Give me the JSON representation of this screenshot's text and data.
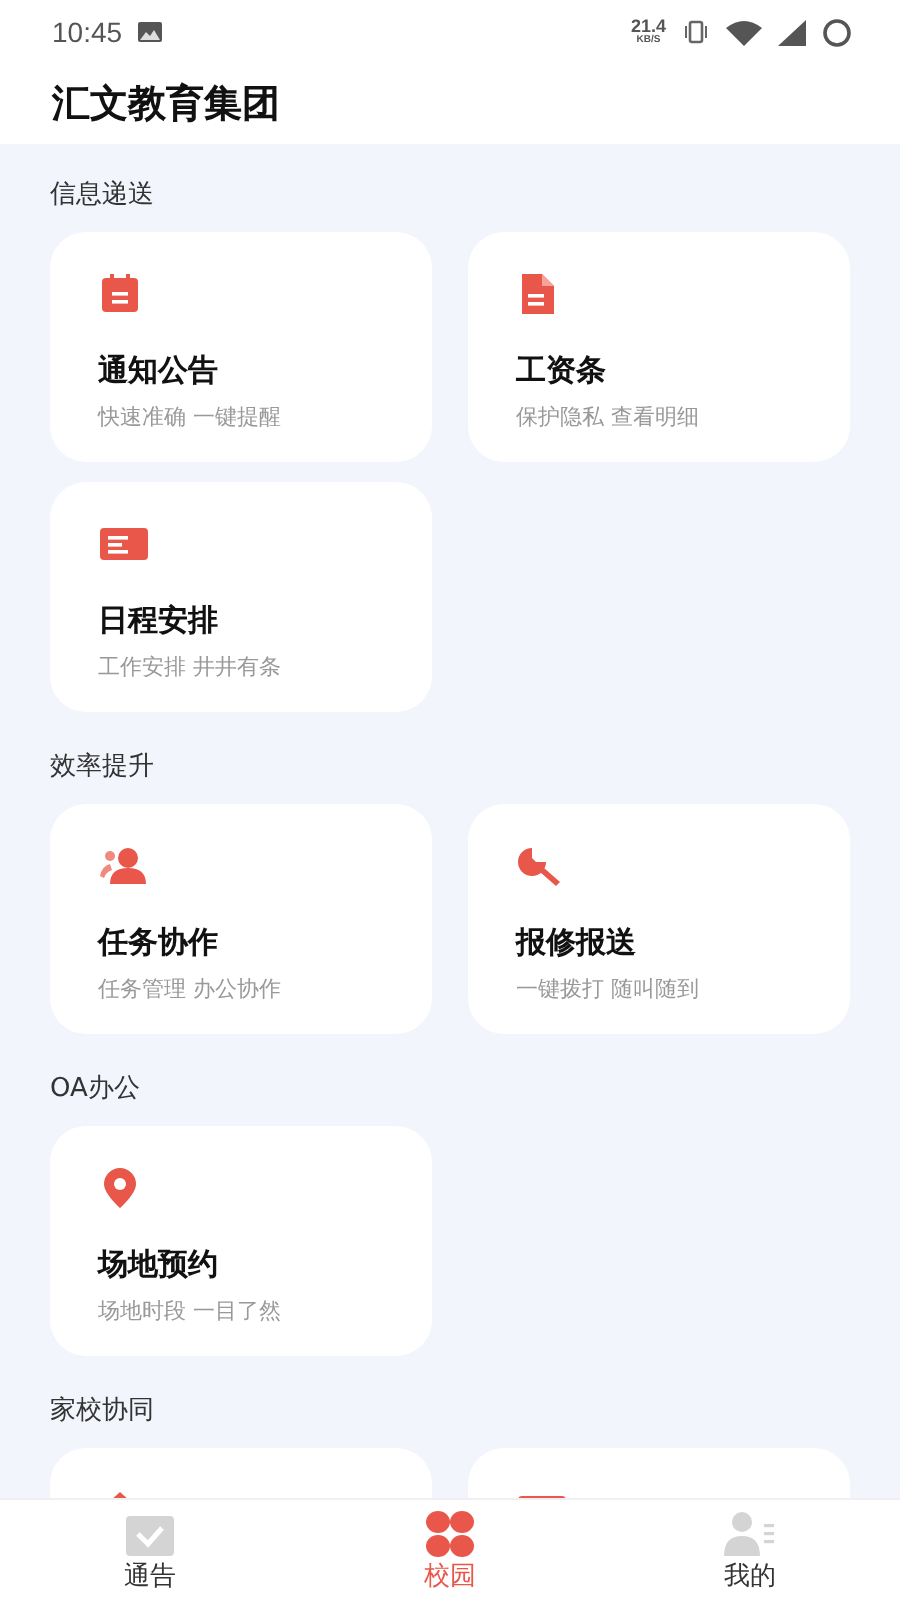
{
  "status_bar": {
    "time": "10:45",
    "speed_value": "21.4",
    "speed_unit": "KB/S"
  },
  "header": {
    "title": "汇文教育集团"
  },
  "sections": [
    {
      "label": "信息递送",
      "cards": [
        {
          "kind": "calendar",
          "title": "通知公告",
          "subtitle": "快速准确 一键提醒"
        },
        {
          "kind": "document",
          "title": "工资条",
          "subtitle": "保护隐私 查看明细"
        },
        {
          "kind": "list",
          "title": "日程安排",
          "subtitle": "工作安排 井井有条"
        }
      ]
    },
    {
      "label": "效率提升",
      "cards": [
        {
          "kind": "people",
          "title": "任务协作",
          "subtitle": "任务管理 办公协作"
        },
        {
          "kind": "wrench",
          "title": "报修报送",
          "subtitle": "一键拨打 随叫随到"
        }
      ]
    },
    {
      "label": "OA办公",
      "cards": [
        {
          "kind": "pin",
          "title": "场地预约",
          "subtitle": "场地时段 一目了然"
        }
      ]
    },
    {
      "label": "家校协同",
      "cards": [
        {
          "kind": "house"
        },
        {
          "kind": "bar"
        }
      ]
    }
  ],
  "tab_bar": [
    {
      "kind": "calendar",
      "label": "通告",
      "selected": false
    },
    {
      "kind": "grid",
      "label": "校园",
      "selected": true
    },
    {
      "kind": "person",
      "label": "我的",
      "selected": false
    }
  ]
}
